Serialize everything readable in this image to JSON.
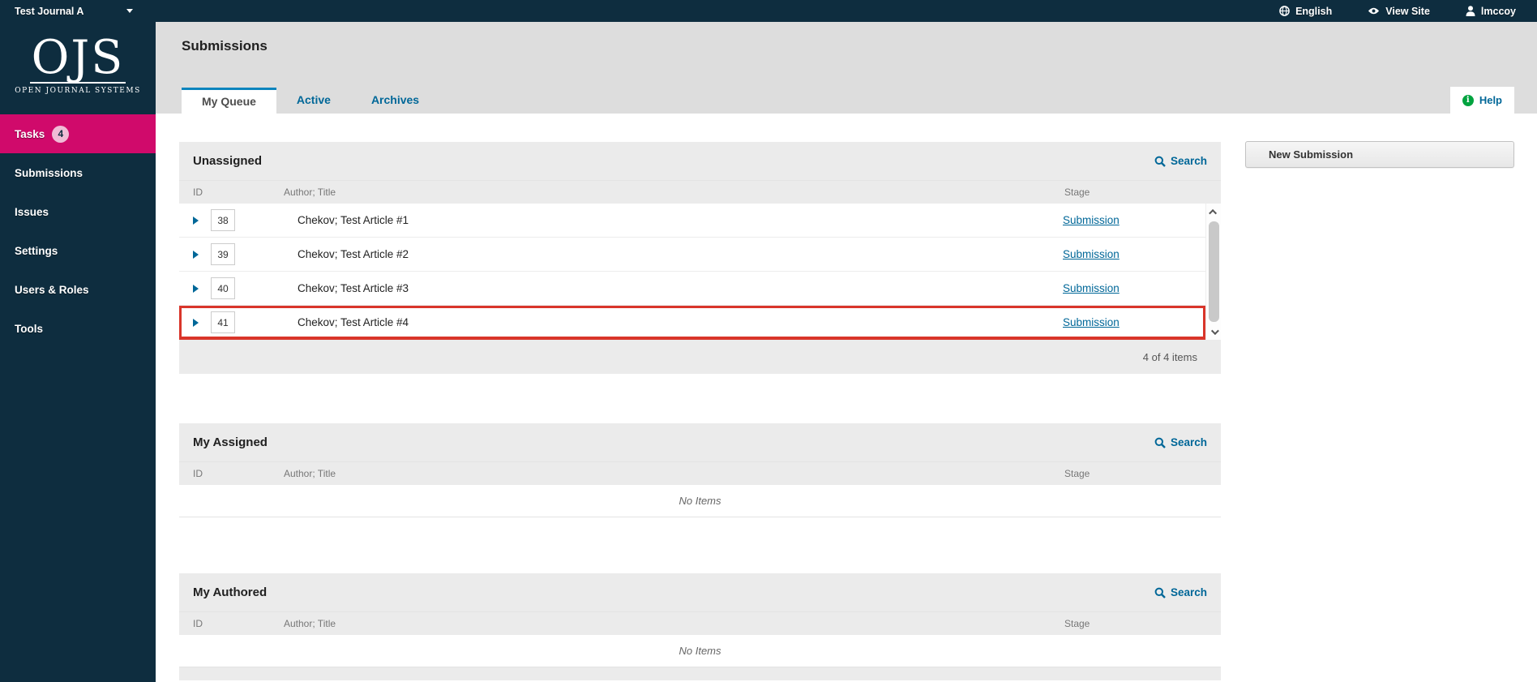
{
  "top_bar": {
    "journal_name": "Test Journal A",
    "language_label": "English",
    "view_site_label": "View Site",
    "user_label": "lmccoy"
  },
  "logo": {
    "title": "OJS",
    "subtitle": "OPEN JOURNAL SYSTEMS"
  },
  "sidebar": {
    "items": [
      {
        "label": "Tasks",
        "badge": "4",
        "active": true
      },
      {
        "label": "Submissions",
        "active": false
      },
      {
        "label": "Issues",
        "active": false
      },
      {
        "label": "Settings",
        "active": false
      },
      {
        "label": "Users & Roles",
        "active": false
      },
      {
        "label": "Tools",
        "active": false
      }
    ]
  },
  "page": {
    "title": "Submissions",
    "tabs": [
      {
        "label": "My Queue",
        "active": true
      },
      {
        "label": "Active",
        "active": false
      },
      {
        "label": "Archives",
        "active": false
      }
    ],
    "help_label": "Help",
    "new_submission_label": "New Submission"
  },
  "panels": {
    "unassigned": {
      "title": "Unassigned",
      "search_label": "Search",
      "columns": {
        "id": "ID",
        "author_title": "Author; Title",
        "stage": "Stage"
      },
      "rows": [
        {
          "id": "38",
          "title": "Chekov; Test Article #1",
          "stage": "Submission",
          "highlighted": false
        },
        {
          "id": "39",
          "title": "Chekov; Test Article #2",
          "stage": "Submission",
          "highlighted": false
        },
        {
          "id": "40",
          "title": "Chekov; Test Article #3",
          "stage": "Submission",
          "highlighted": false
        },
        {
          "id": "41",
          "title": "Chekov; Test Article #4",
          "stage": "Submission",
          "highlighted": true
        }
      ],
      "footer": "4 of 4 items"
    },
    "my_assigned": {
      "title": "My Assigned",
      "search_label": "Search",
      "columns": {
        "id": "ID",
        "author_title": "Author; Title",
        "stage": "Stage"
      },
      "empty_label": "No Items"
    },
    "my_authored": {
      "title": "My Authored",
      "search_label": "Search",
      "columns": {
        "id": "ID",
        "author_title": "Author; Title",
        "stage": "Stage"
      },
      "empty_label": "No Items"
    }
  },
  "icons": {
    "language": "globe-icon",
    "view_site": "eye-icon",
    "user": "user-icon",
    "search": "search-icon",
    "help": "info-icon",
    "expand_row": "triangle-right-icon"
  },
  "colors": {
    "navy": "#0e2d3f",
    "accent_magenta": "#d00a6b",
    "badge_pink": "#f0bcd6",
    "link_blue": "#006798",
    "tab_border_blue": "#0b84bd",
    "help_green": "#00a33f",
    "highlight_red": "#d9352a",
    "header_gray": "#dddddd",
    "panel_gray": "#ebebeb"
  }
}
